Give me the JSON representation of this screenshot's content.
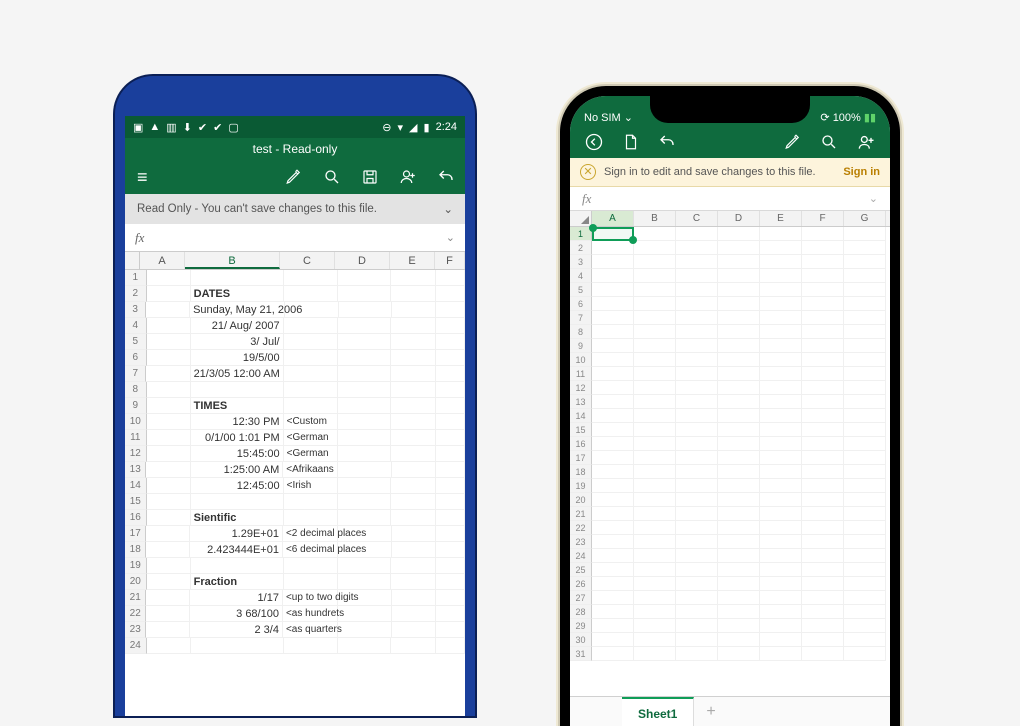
{
  "android": {
    "status": {
      "left_icons": [
        "camera-icon",
        "cloud-icon",
        "image-icon",
        "download-icon",
        "clipboard-icon",
        "clipboard-icon",
        "briefcase-icon"
      ],
      "right_icons": [
        "do-not-disturb-icon",
        "wifi-icon",
        "signal-icon",
        "battery-icon"
      ],
      "time": "2:24"
    },
    "title": "test - Read-only",
    "toolbar": {
      "menu": "≡",
      "icons": [
        "edit-pen-icon",
        "search-icon",
        "save-icon",
        "add-user-icon",
        "undo-icon"
      ]
    },
    "banner": {
      "text": "Read Only - You can't save changes to this file.",
      "expand": "⌄"
    },
    "fx_label": "fx",
    "columns": [
      "A",
      "B",
      "C",
      "D",
      "E",
      "F"
    ],
    "selected_column": "B",
    "rows": [
      {
        "n": 1
      },
      {
        "n": 2,
        "b": "DATES",
        "b_bold": true
      },
      {
        "n": 3,
        "b": "Sunday, May 21, 2006"
      },
      {
        "n": 4,
        "b": "21/ Aug/ 2007"
      },
      {
        "n": 5,
        "b": "3/ Jul/"
      },
      {
        "n": 6,
        "b": "19/5/00"
      },
      {
        "n": 7,
        "b": "21/3/05 12:00 AM"
      },
      {
        "n": 8
      },
      {
        "n": 9,
        "b": "TIMES",
        "b_bold": true
      },
      {
        "n": 10,
        "b": "12:30 PM",
        "c": "<Custom"
      },
      {
        "n": 11,
        "b": "0/1/00 1:01 PM",
        "c": "<German"
      },
      {
        "n": 12,
        "b": "15:45:00",
        "c": "<German"
      },
      {
        "n": 13,
        "b": "1:25:00 AM",
        "c": "<Afrikaans"
      },
      {
        "n": 14,
        "b": "12:45:00",
        "c": "<Irish"
      },
      {
        "n": 15
      },
      {
        "n": 16,
        "b": "Sientific",
        "b_bold": true
      },
      {
        "n": 17,
        "b": "1.29E+01",
        "c": "<2 decimal places"
      },
      {
        "n": 18,
        "b": "2.423444E+01",
        "c": "<6 decimal places"
      },
      {
        "n": 19
      },
      {
        "n": 20,
        "b": "Fraction",
        "b_bold": true
      },
      {
        "n": 21,
        "b": "1/17",
        "c": "<up to two digits"
      },
      {
        "n": 22,
        "b": "3 68/100",
        "c": "<as hundrets"
      },
      {
        "n": 23,
        "b": "2 3/4",
        "c": "<as quarters"
      },
      {
        "n": 24
      }
    ]
  },
  "iphone": {
    "status": {
      "carrier": "No SIM",
      "wifi": "wifi-icon",
      "battery_pct": "100%"
    },
    "toolbar": {
      "icons_left": [
        "back-icon",
        "new-file-icon",
        "undo-icon"
      ],
      "icons_right": [
        "edit-pen-icon",
        "search-icon",
        "add-user-icon"
      ]
    },
    "banner": {
      "text": "Sign in to edit and save changes to this file.",
      "button": "Sign in"
    },
    "fx_label": "fx",
    "columns": [
      "A",
      "B",
      "C",
      "D",
      "E",
      "F",
      "G"
    ],
    "selected_cell": "A1",
    "row_count": 31,
    "sheet_tabs": {
      "active": "Sheet1",
      "plus": "+"
    }
  }
}
